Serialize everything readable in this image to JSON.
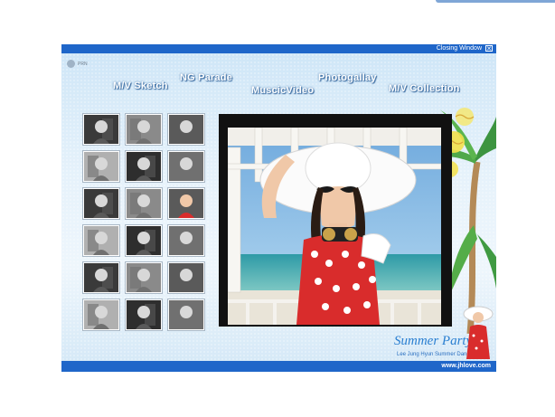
{
  "window": {
    "logo_text": "PRN",
    "closing_label": "Closing Window",
    "close_glyph": "✕"
  },
  "nav": [
    {
      "label": "M/V Sketch"
    },
    {
      "label": "NG Parade"
    },
    {
      "label": "MuscicVideo"
    },
    {
      "label": "Photogallay"
    },
    {
      "label": "M/V Collection"
    }
  ],
  "thumbnails_count": 18,
  "branding": {
    "title": "Summer Party",
    "subtitle": "Lee Jung Hyun Summer Dance",
    "url": "www.jhlove.com"
  },
  "colors": {
    "titlebar": "#1f66c9",
    "accent": "#2a7fd1"
  }
}
